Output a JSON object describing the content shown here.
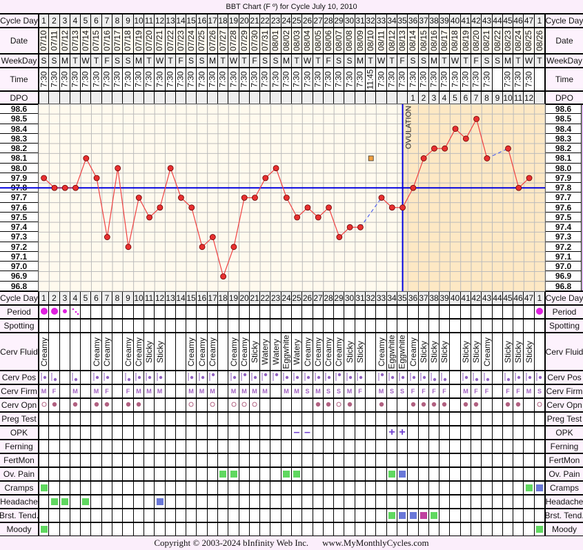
{
  "title": "BBT Chart (F º) for Cycle July 10, 2010",
  "row_labels": {
    "cycle_day": "Cycle Day",
    "date": "Date",
    "weekday": "WeekDay",
    "time": "Time",
    "dpo": "DPO",
    "period": "Period",
    "spotting": "Spotting",
    "cerv_fluid": "Cerv Fluid",
    "cerv_pos": "Cerv Pos",
    "cerv_firm": "Cerv Firm",
    "cerv_opn": "Cerv Opn",
    "preg_test": "Preg Test",
    "opk": "OPK",
    "ferning": "Ferning",
    "fertmon": "FertMon",
    "ov_pain": "Ov. Pain",
    "cramps": "Cramps",
    "headache": "Headache",
    "brst_tend": "Brst. Tend.",
    "moody": "Moody"
  },
  "cycle_days": [
    "1",
    "2",
    "3",
    "4",
    "5",
    "6",
    "7",
    "8",
    "9",
    "10",
    "11",
    "12",
    "13",
    "14",
    "15",
    "16",
    "17",
    "18",
    "19",
    "20",
    "21",
    "22",
    "23",
    "24",
    "25",
    "26",
    "27",
    "28",
    "29",
    "30",
    "31",
    "32",
    "33",
    "34",
    "35",
    "36",
    "37",
    "38",
    "39",
    "40",
    "41",
    "42",
    "43",
    "44",
    "45",
    "46",
    "47",
    "1"
  ],
  "dates": [
    "07/10",
    "07/11",
    "07/12",
    "07/13",
    "07/14",
    "07/15",
    "07/16",
    "07/17",
    "07/18",
    "07/19",
    "07/20",
    "07/21",
    "07/22",
    "07/23",
    "07/24",
    "07/25",
    "07/26",
    "07/27",
    "07/28",
    "07/29",
    "07/30",
    "07/31",
    "08/01",
    "08/02",
    "08/03",
    "08/04",
    "08/05",
    "08/06",
    "08/07",
    "08/08",
    "08/09",
    "08/10",
    "08/11",
    "08/12",
    "08/13",
    "08/14",
    "08/15",
    "08/16",
    "08/17",
    "08/18",
    "08/19",
    "08/20",
    "08/21",
    "08/22",
    "08/23",
    "08/24",
    "08/25",
    "08/26"
  ],
  "weekdays": [
    "S",
    "S",
    "M",
    "T",
    "W",
    "T",
    "F",
    "S",
    "S",
    "M",
    "T",
    "W",
    "T",
    "F",
    "S",
    "S",
    "M",
    "T",
    "W",
    "T",
    "F",
    "S",
    "S",
    "M",
    "T",
    "W",
    "T",
    "F",
    "S",
    "S",
    "M",
    "T",
    "W",
    "T",
    "F",
    "S",
    "S",
    "M",
    "T",
    "W",
    "T",
    "F",
    "S",
    "S",
    "M",
    "T",
    "W",
    "T"
  ],
  "times": [
    "7:30",
    "7:30",
    "7:30",
    "7:30",
    "7:30",
    "7:30",
    "7:30",
    "7:30",
    "7:30",
    "7:30",
    "7:30",
    "7:30",
    "7:30",
    "7:30",
    "7:30",
    "7:30",
    "7:30",
    "7:30",
    "7:30",
    "7:30",
    "7:30",
    "7:30",
    "7:30",
    "7:30",
    "7:30",
    "7:30",
    "7:30",
    "7:30",
    "7:30",
    "7:30",
    "7:30",
    "11:45",
    "7:30",
    "7:30",
    "7:30",
    "7:30",
    "7:30",
    "7:30",
    "7:30",
    "7:30",
    "7:30",
    "7:30",
    "7:30",
    "",
    "7:30",
    "7:30",
    "7:30",
    ""
  ],
  "dpo": [
    "",
    "",
    "",
    "",
    "",
    "",
    "",
    "",
    "",
    "",
    "",
    "",
    "",
    "",
    "",
    "",
    "",
    "",
    "",
    "",
    "",
    "",
    "",
    "",
    "",
    "",
    "",
    "",
    "",
    "",
    "",
    "",
    "",
    "",
    "",
    "1",
    "2",
    "3",
    "4",
    "5",
    "6",
    "7",
    "8",
    "9",
    "10",
    "11",
    "12",
    ""
  ],
  "chart_data": {
    "type": "line",
    "y_ticks": [
      "98.6",
      "98.5",
      "98.4",
      "98.3",
      "98.2",
      "98.1",
      "98.0",
      "97.9",
      "97.8",
      "97.7",
      "97.6",
      "97.5",
      "97.4",
      "97.3",
      "97.2",
      "97.1",
      "97.0",
      "96.9",
      "96.8"
    ],
    "ylim": [
      96.8,
      98.6
    ],
    "temps": [
      97.9,
      97.8,
      97.8,
      97.8,
      98.1,
      97.9,
      97.3,
      98.0,
      97.2,
      97.7,
      97.5,
      97.6,
      98.0,
      97.7,
      97.6,
      97.2,
      97.3,
      96.9,
      97.2,
      97.7,
      97.7,
      97.9,
      98.0,
      97.7,
      97.5,
      97.6,
      97.5,
      97.6,
      97.3,
      97.4,
      97.4,
      null,
      97.7,
      97.6,
      97.6,
      97.8,
      98.1,
      98.2,
      98.2,
      98.4,
      98.3,
      98.5,
      98.1,
      null,
      98.2,
      97.8,
      97.9,
      null
    ],
    "discarded": {
      "cycle_day": 32,
      "temp": 98.1
    },
    "coverline": 97.8,
    "ovulation_cycle_day": 35,
    "ovulation_label": "OVULATION",
    "grid": true,
    "colors": {
      "line": "#f04040",
      "point": "#e83030",
      "coverline": "#0000e0",
      "luteal_shade": "#fde8c4",
      "follicular_bg": "#fffaee",
      "discarded": "#f0a040"
    }
  },
  "period": [
    "heavy",
    "heavy",
    "medium",
    "light",
    "",
    "",
    "",
    "",
    "",
    "",
    "",
    "",
    "",
    "",
    "",
    "",
    "",
    "",
    "",
    "",
    "",
    "",
    "",
    "",
    "",
    "",
    "",
    "",
    "",
    "",
    "",
    "",
    "",
    "",
    "",
    "",
    "",
    "",
    "",
    "",
    "",
    "",
    "",
    "",
    "",
    "",
    "",
    "heavy"
  ],
  "spotting": [],
  "cerv_fluid": [
    "Creamy",
    "",
    "",
    "",
    "",
    "Creamy",
    "Creamy",
    "",
    "Creamy",
    "Creamy",
    "Sticky",
    "Sticky",
    "",
    "",
    "Creamy",
    "Creamy",
    "Creamy",
    "",
    "Creamy",
    "Creamy",
    "Sticky",
    "Watery",
    "Watery",
    "Eggwhite",
    "Watery",
    "Creamy",
    "Creamy",
    "Creamy",
    "Creamy",
    "Sticky",
    "Sticky",
    "",
    "Creamy",
    "Eggwhite",
    "Eggwhite",
    "Creamy",
    "Sticky",
    "Sticky",
    "Sticky",
    "",
    "Sticky",
    "Sticky",
    "Creamy",
    "",
    "Sticky",
    "Sticky",
    "Sticky",
    ""
  ],
  "cerv_pos": [
    "mid",
    "low",
    "",
    "low",
    "",
    "mid",
    "mid",
    "",
    "low",
    "mid",
    "mid",
    "mid",
    "",
    "",
    "mid",
    "mid",
    "high",
    "",
    "mid",
    "high",
    "mid",
    "high",
    "high",
    "mid",
    "mid",
    "mid",
    "mid",
    "mid",
    "high",
    "mid",
    "mid",
    "",
    "high",
    "mid",
    "mid",
    "mid",
    "mid",
    "low",
    "low",
    "",
    "mid",
    "low",
    "low",
    "",
    "low",
    "mid",
    "mid",
    "mid"
  ],
  "cerv_firm": [
    "M",
    "F",
    "",
    "M",
    "",
    "M",
    "F",
    "",
    "F",
    "M",
    "M",
    "M",
    "",
    "",
    "M",
    "M",
    "M",
    "",
    "M",
    "M",
    "M",
    "M",
    "",
    "M",
    "M",
    "S",
    "M",
    "S",
    "S",
    "M",
    "F",
    "",
    "M",
    "S",
    "S",
    "F",
    "F",
    "F",
    "F",
    "",
    "M",
    "F",
    "F",
    "",
    "F",
    "F",
    "M",
    "S"
  ],
  "cerv_opn": [
    "open",
    "closed",
    "",
    "closed",
    "",
    "closed",
    "closed",
    "",
    "closed",
    "closed",
    "",
    "",
    "",
    "",
    "open",
    "",
    "open",
    "",
    "open",
    "open",
    "open",
    "",
    "",
    "",
    "",
    "",
    "closed",
    "closed",
    "open",
    "closed",
    "",
    "",
    "closed",
    "",
    "",
    "closed",
    "closed",
    "closed",
    "closed",
    "",
    "closed",
    "closed",
    "",
    "",
    "closed",
    "closed",
    "",
    "open"
  ],
  "opk": [
    "",
    "",
    "",
    "",
    "",
    "",
    "",
    "",
    "",
    "",
    "",
    "",
    "",
    "",
    "",
    "",
    "",
    "",
    "",
    "",
    "",
    "",
    "",
    "",
    "–",
    "–",
    "",
    "",
    "",
    "",
    "",
    "",
    "",
    "+",
    "+",
    "",
    "",
    "",
    "",
    "",
    "",
    "",
    "",
    "",
    "",
    "",
    "",
    ""
  ],
  "symptom_levels": {
    "ov_pain": {
      "18": 1,
      "19": 1,
      "24": 1,
      "25": 1,
      "34": 1,
      "35": 2
    },
    "cramps": {
      "1": 1,
      "47": 1,
      "48": 2
    },
    "headache": {
      "2": 1,
      "3": 1,
      "5": 1,
      "12": 2
    },
    "brst_tend": {
      "34": 1,
      "35": 2,
      "36": 2,
      "37": 3,
      "38": 1
    },
    "moody": {
      "1": 1,
      "48": 1
    }
  },
  "colors": {
    "level_1": "#60d860",
    "level_2": "#6a78d8",
    "level_3": "#c040a0",
    "period": "#e020e0",
    "cerv": "#9060c0",
    "opn": "#b06080",
    "frame": "#c080f0",
    "label_bg": "#fdf2fd"
  },
  "footer": {
    "copyright": "Copyright © 2003-2024 bInfinity Web Inc.",
    "url": "www.MyMonthlyCycles.com"
  }
}
